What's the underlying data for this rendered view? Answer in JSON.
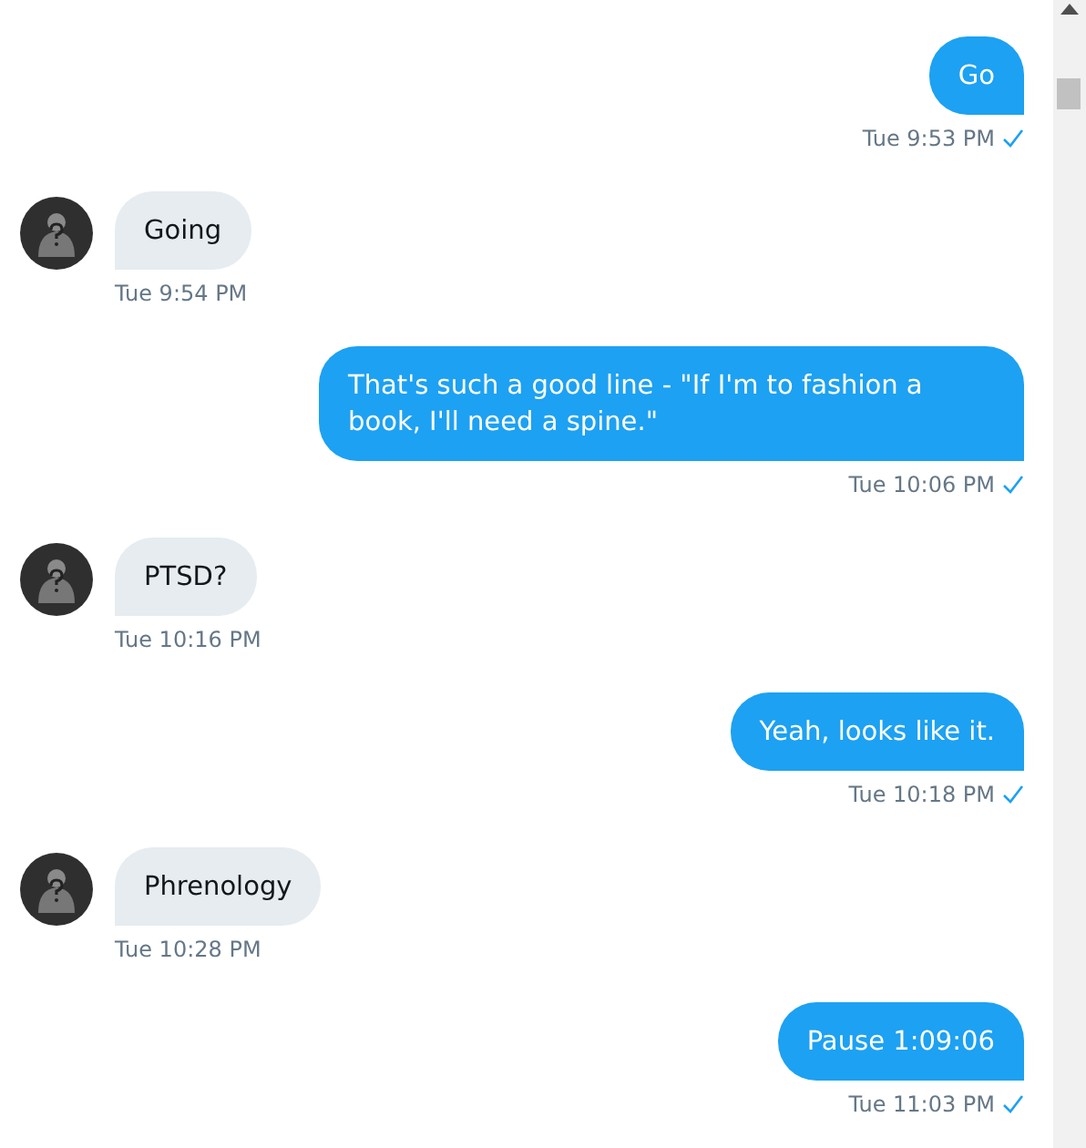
{
  "messages": [
    {
      "kind": "sent",
      "text": "Go",
      "time": "Tue 9:53 PM",
      "seen": true
    },
    {
      "kind": "received",
      "text": "Going",
      "time": "Tue 9:54 PM"
    },
    {
      "kind": "sent",
      "text": "That's such a good line - \"If I'm to fashion a book, I'll need a spine.\"",
      "time": "Tue 10:06 PM",
      "seen": true
    },
    {
      "kind": "received",
      "text": "PTSD?",
      "time": "Tue 10:16 PM"
    },
    {
      "kind": "sent",
      "text": "Yeah, looks like it.",
      "time": "Tue 10:18 PM",
      "seen": true
    },
    {
      "kind": "received",
      "text": "Phrenology",
      "time": "Tue 10:28 PM"
    },
    {
      "kind": "sent",
      "text": "Pause 1:09:06",
      "time": "Tue 11:03 PM",
      "seen": true
    }
  ]
}
